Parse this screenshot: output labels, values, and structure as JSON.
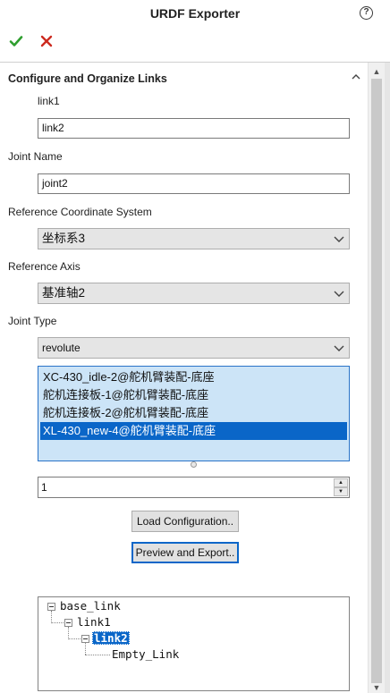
{
  "window": {
    "title": "URDF Exporter"
  },
  "section": {
    "title": "Configure and Organize Links"
  },
  "fields": {
    "parent_link_label": "link1",
    "link_name_value": "link2",
    "joint_name_label": "Joint Name",
    "joint_name_value": "joint2",
    "ref_coord_label": "Reference Coordinate System",
    "ref_coord_value": "坐标系3",
    "ref_axis_label": "Reference Axis",
    "ref_axis_value": "基准轴2",
    "joint_type_label": "Joint Type",
    "joint_type_value": "revolute"
  },
  "components": [
    "XC-430_idle-2@舵机臂装配-底座",
    "舵机连接板-1@舵机臂装配-底座",
    "舵机连接板-2@舵机臂装配-底座",
    "XL-430_new-4@舵机臂装配-底座"
  ],
  "selected_component_index": 3,
  "child_count": {
    "value": "1"
  },
  "buttons": {
    "load": "Load Configuration..",
    "export": "Preview and Export.."
  },
  "tree": {
    "root": "base_link",
    "child": "link1",
    "grandchild": "link2",
    "leaf": "Empty_Link"
  },
  "colors": {
    "accent": "#0a66c8",
    "list_background": "#cce4f7",
    "ok_green": "#2e9e2e",
    "cancel_red": "#cc2a1f"
  },
  "icons": {
    "ok": "checkmark-icon",
    "cancel": "close-icon",
    "help": "help-icon",
    "collapse": "chevron-up-icon"
  }
}
